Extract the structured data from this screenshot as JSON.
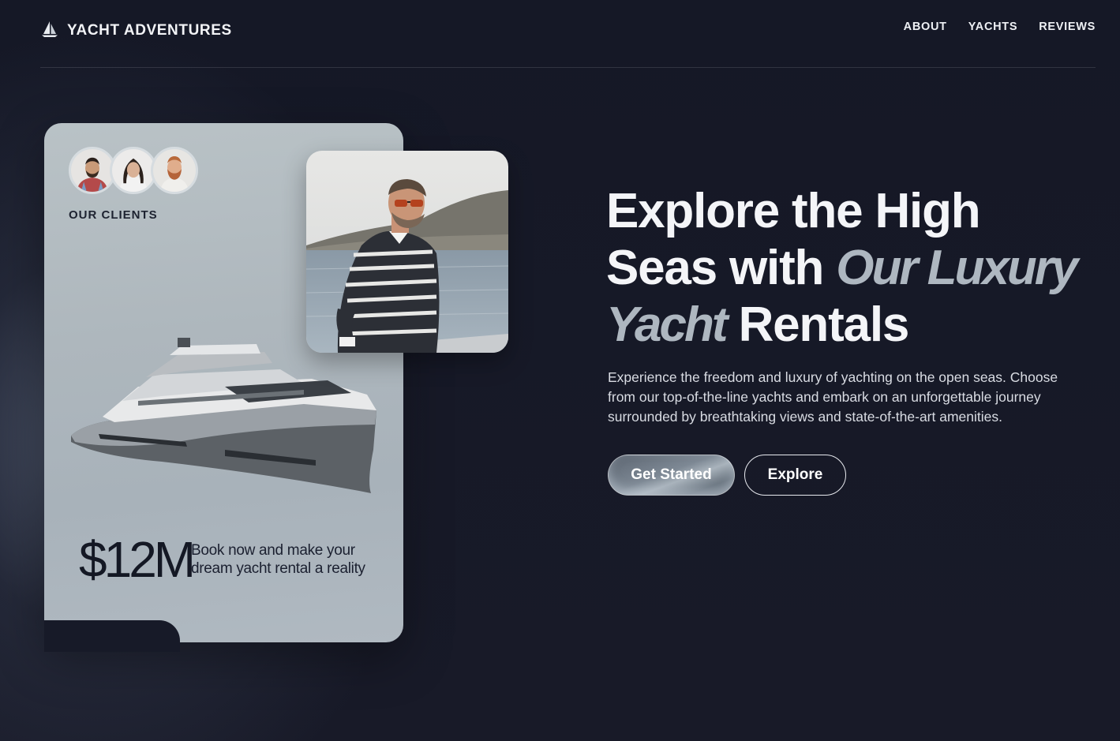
{
  "brand": {
    "name": "YACHT ADVENTURES",
    "logo_icon": "sailboat-icon"
  },
  "nav": {
    "items": [
      {
        "label": "ABOUT"
      },
      {
        "label": "YACHTS"
      },
      {
        "label": "REVIEWS"
      }
    ]
  },
  "card": {
    "clients_label": "OUR CLIENTS",
    "price": "$12M",
    "caption": "Book now and make your dream yacht rental a reality"
  },
  "hero": {
    "title_line1": "Explore the High",
    "title_line2_plain": "Seas with ",
    "title_line2_italic": "Our Luxury",
    "title_line3_italic": "Yacht",
    "title_line3_plain": " Rentals",
    "description": "Experience the freedom and luxury of yachting on the open seas. Choose from our top-of-the-line yachts and embark on an unforgettable journey surrounded by breathtaking views and state-of-the-art amenities.",
    "primary_button": "Get Started",
    "secondary_button": "Explore"
  },
  "colors": {
    "background": "#161826",
    "card": "#b3bcc2",
    "accent_italic": "#aeb7c0"
  }
}
